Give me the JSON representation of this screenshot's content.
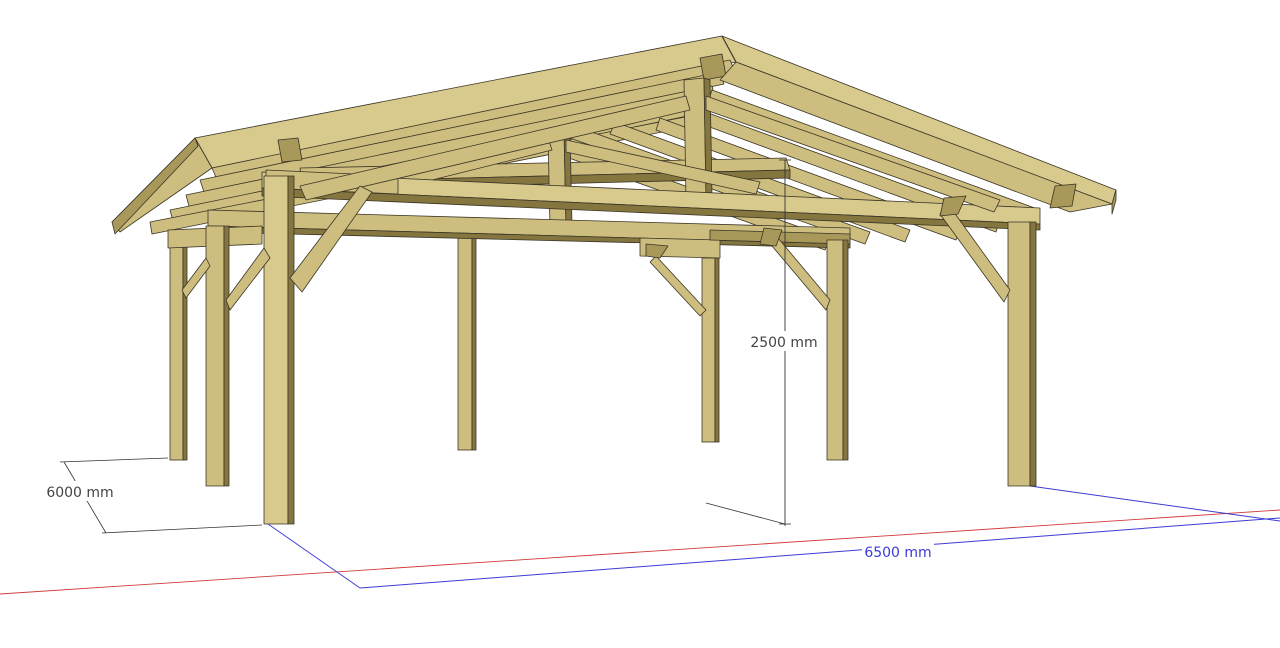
{
  "model": {
    "name": "",
    "colors": {
      "timber_top": "#d8c98c",
      "timber_light": "#cdbd7e",
      "timber_side": "#a8985a",
      "timber_dark": "#857640",
      "edge": "#3a3526",
      "background": "#ffffff",
      "axis_red": "#d23a3a",
      "axis_blue": "#3b3bd6",
      "dimension_line": "#333333"
    }
  },
  "dimensions": {
    "height_label": "2500 mm",
    "depth_label": "6000 mm",
    "width_label": "6500 mm"
  }
}
